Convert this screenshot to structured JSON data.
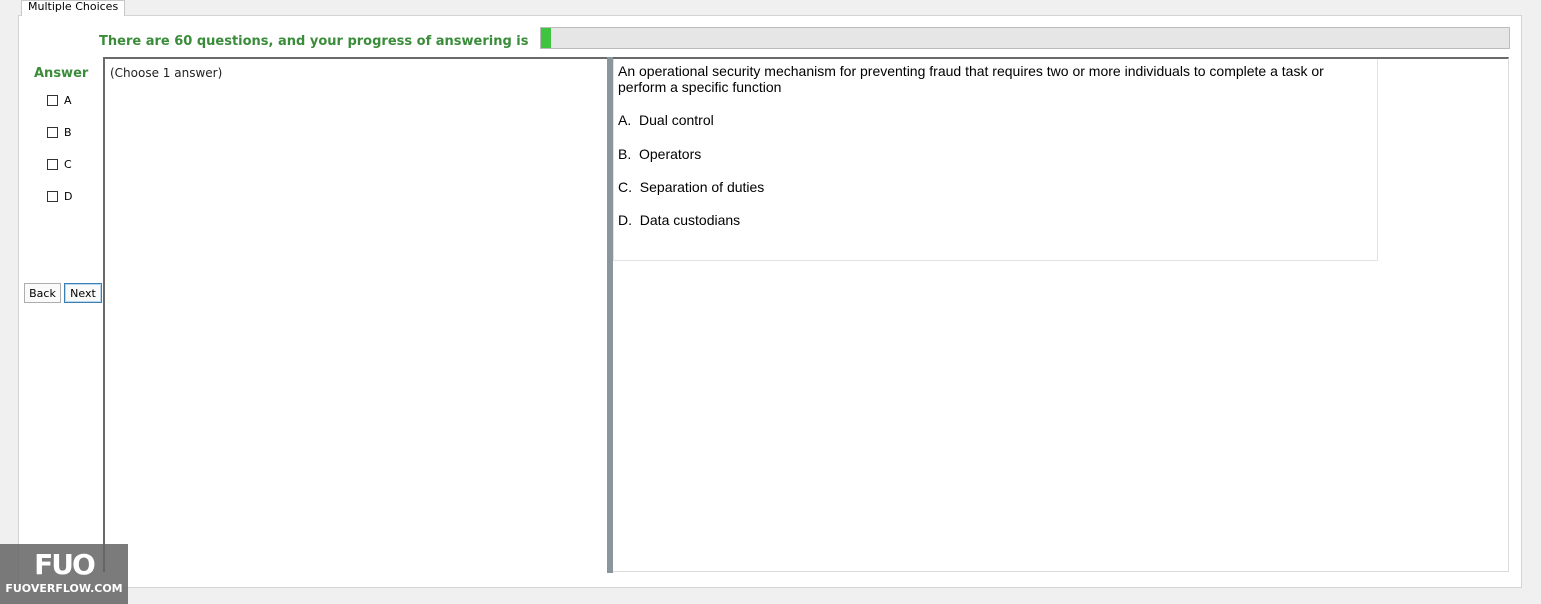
{
  "tab": {
    "label": "Multiple Choices"
  },
  "progress": {
    "label": "There are 60 questions, and your progress of answering is",
    "fraction": 0.01,
    "fill_color": "#3ec43e"
  },
  "answer_panel": {
    "title": "Answer",
    "options": [
      "A",
      "B",
      "C",
      "D"
    ]
  },
  "buttons": {
    "back": "Back",
    "next": "Next"
  },
  "instruction": "(Choose 1 answer)",
  "question": {
    "text": "An operational security mechanism for preventing fraud that requires two or more individuals to complete a task or perform a specific function",
    "choices": [
      "A.  Dual control",
      "B.  Operators",
      "C.  Separation of duties",
      "D.  Data custodians"
    ]
  },
  "watermark": {
    "logo": "FUO",
    "text": "FUOVERFLOW.COM"
  }
}
